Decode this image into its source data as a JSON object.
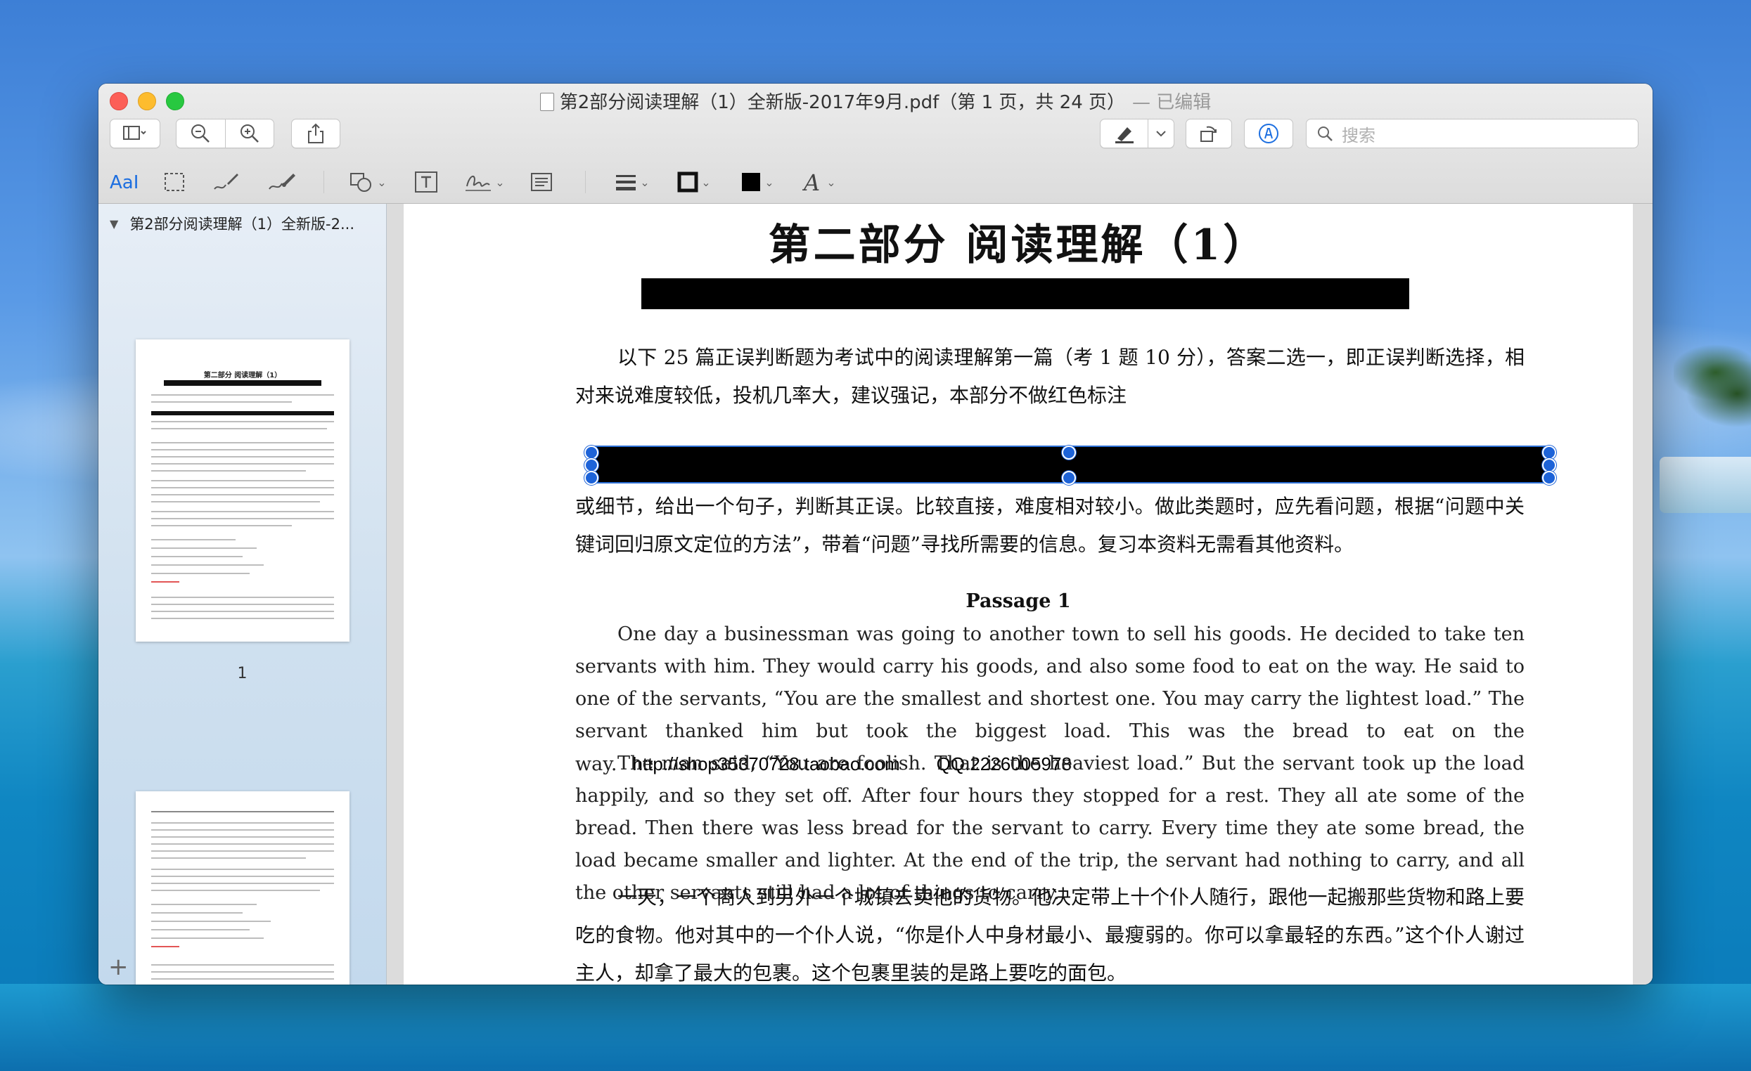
{
  "window": {
    "title": "第2部分阅读理解（1）全新版-2017年9月.pdf（第 1 页，共 24 页）",
    "edited_label": "— 已编辑"
  },
  "toolbar": {
    "search_placeholder": "搜索"
  },
  "sidebar": {
    "header": "第2部分阅读理解（1）全新版-2...",
    "thumb1_title": "第二部分 阅读理解（1）",
    "page1_number": "1"
  },
  "document": {
    "heading": "第二部分  阅读理解（1）",
    "intro": "以下 25 篇正误判断题为考试中的阅读理解第一篇（考 1 题 10 分），答案二选一，即正误判断选择，相对来说难度较低，投机几率大，建议强记，本部分不做红色标注",
    "paragraph2": "或细节，给出一个句子，判断其正误。比较直接，难度相对较小。做此类题时，应先看问题，根据“问题中关键词回归原文定位的方法”，带着“问题”寻找所需要的信息。复习本资料无需看其他资料。",
    "passage_title": "Passage 1",
    "en_p1": "One day a businessman was going to another town to sell his goods. He decided to take ten servants with him. They would carry his goods, and also some food to eat on the way. He said to one of the servants, “You are the smallest and shortest one. You may carry the lightest load.” The servant thanked him but took the biggest load. This was the bread to eat on the way.",
    "watermark_url": "http://shop35370728.taobao.com",
    "watermark_qq": "QQ:2226005978",
    "en_p2": "The man said, “You are foolish. That is the heaviest load.” But the servant took up the load happily, and so they set off. After four hours they stopped for a rest. They all ate some of the bread. Then there was less bread for the servant to carry. Every time they ate some bread, the load became smaller and lighter. At the end of the trip, the servant had nothing to carry, and all the other servants still had a lot of things to carry.",
    "cn_p3": "一天，一个商人到另外一个城镇去卖他的货物。他决定带上十个仆人随行，跟他一起搬那些货物和路上要吃的食物。他对其中的一个仆人说，“你是仆人中身材最小、最瘦弱的。你可以拿最轻的东西。”这个仆人谢过主人，却拿了最大的包裹。这个包裹里装的是路上要吃的面包。"
  }
}
